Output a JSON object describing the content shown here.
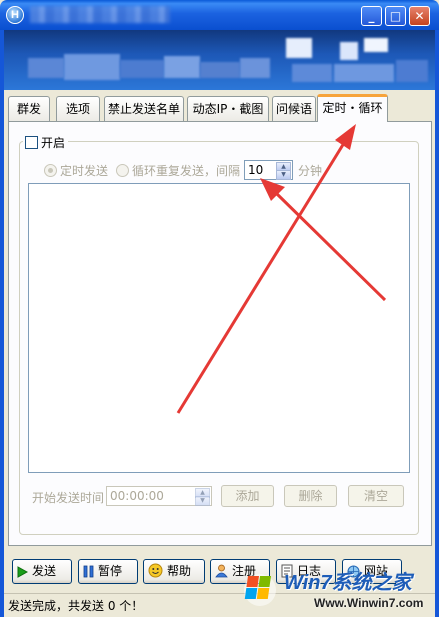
{
  "window": {
    "app_icon_letter": "H",
    "controls": {
      "minimize": "_",
      "maximize": "□",
      "close": "✕"
    }
  },
  "tabs": [
    {
      "label": "群发",
      "active": false
    },
    {
      "label": "选项",
      "active": false
    },
    {
      "label": "禁止发送名单",
      "active": false
    },
    {
      "label": "动态IP・截图",
      "active": false
    },
    {
      "label": "问候语",
      "active": false
    },
    {
      "label": "定时・循环",
      "active": true
    }
  ],
  "timer_panel": {
    "enable_label": "开启",
    "enabled": false,
    "radio_scheduled": "定时发送",
    "radio_loop": "循环重复发送，间隔",
    "interval_value": "10",
    "interval_unit": "分钟",
    "message_text": "",
    "start_time_label": "开始发送时间",
    "start_time_value": "00:00:00",
    "add_button": "添加",
    "delete_button": "删除",
    "clear_button": "清空"
  },
  "bottom_buttons": {
    "send": "发送",
    "pause": "暂停",
    "help": "帮助",
    "register": "注册",
    "log": "日志",
    "website": "网站"
  },
  "status": {
    "text": "发送完成，共发送 0 个！"
  },
  "watermark": {
    "brand": "Win7系统之家",
    "url": "Www.Winwin7.com"
  },
  "colors": {
    "title_bar": "#0a55d4",
    "active_tab_accent": "#f7a43b",
    "annotation_arrow": "#e53935"
  }
}
